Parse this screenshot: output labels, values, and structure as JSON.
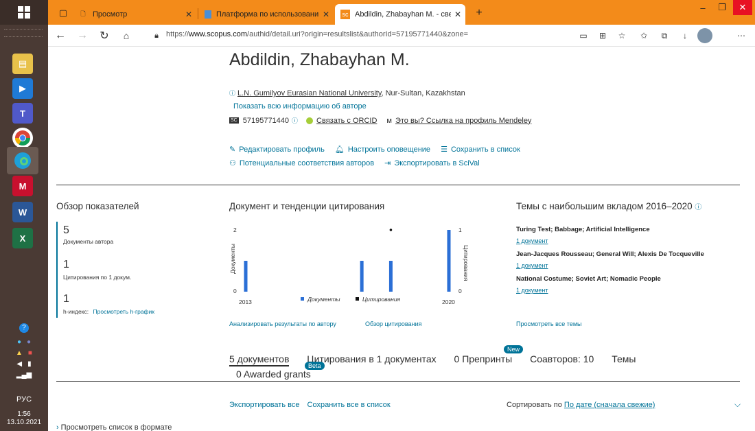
{
  "taskbar": {
    "language": "РУС",
    "time": "1:56",
    "date": "13.10.2021"
  },
  "browser": {
    "tabs": [
      {
        "title": "Просмотр"
      },
      {
        "title": "Платформа по использованию"
      },
      {
        "title": "Abdildin, Zhabayhan M. - сведе"
      }
    ],
    "url_prefix": "https://",
    "url_host": "www.scopus.com",
    "url_path": "/authid/detail.uri?origin=resultslist&authorId=57195771440&zone="
  },
  "author": {
    "name": "Abdildin, Zhabayhan M.",
    "affiliation_link": "L.N. Gumilyov Eurasian National University",
    "affiliation_rest": ", Nur-Sultan, Kazakhstan",
    "show_all": "Показать всю информацию об авторе",
    "scopus_id": "57195771440",
    "orcid_link": "Связать с ORCID",
    "mendeley_link": "Это вы? Ссылка на профиль Mendeley"
  },
  "actions": {
    "edit_profile": "Редактировать профиль",
    "alert": "Настроить оповещение",
    "save_list": "Сохранить в список",
    "potential_matches": "Потенциальные соответствия авторов",
    "export_scival": "Экспортировать в SciVal"
  },
  "metrics": {
    "title": "Обзор показателей",
    "docs_count": "5",
    "docs_label": "Документы автора",
    "citations_count": "1",
    "citations_label": "Цитирования по 1 докум.",
    "h_count": "1",
    "h_label": "h-индекс:",
    "h_link": "Просмотреть h-график"
  },
  "chart_section": {
    "title": "Документ и тенденции цитирования",
    "analyze_link": "Анализировать результаты по автору",
    "citation_overview": "Обзор цитирования"
  },
  "chart_data": {
    "type": "bar",
    "x_start_label": "2013",
    "x_end_label": "2020",
    "categories": [
      "2013",
      "2014",
      "2015",
      "2016",
      "2017",
      "2018",
      "2019",
      "2020"
    ],
    "series": [
      {
        "name": "Документы",
        "values": [
          1,
          0,
          0,
          0,
          1,
          1,
          0,
          2
        ],
        "color": "#2b6fd6"
      },
      {
        "name": "Цитирования",
        "values": [
          null,
          null,
          null,
          null,
          null,
          1,
          null,
          null
        ],
        "color": "#111111"
      }
    ],
    "ylabel_left": "Документы",
    "ylabel_right": "Цитирования",
    "ylim_left": [
      0,
      2
    ],
    "ylim_right": [
      0,
      1
    ],
    "left_ticks": [
      "0",
      "2"
    ],
    "right_ticks": [
      "0",
      "1"
    ]
  },
  "topics": {
    "title": "Темы с наибольшим вкладом 2016–2020",
    "items": [
      {
        "name": "Turing Test; Babbage; Artificial Intelligence",
        "docs": "1 документ"
      },
      {
        "name": "Jean-Jacques Rousseau; General Will; Alexis De Tocqueville",
        "docs": "1 документ"
      },
      {
        "name": "National Costume; Soviet Art; Nomadic People",
        "docs": "1 документ"
      }
    ],
    "view_all": "Просмотреть все темы"
  },
  "doc_tabs": {
    "documents": "5 документов",
    "citations": "Цитирования в 1 документах",
    "preprints": "0 Препринты",
    "coauthors": "Соавторов: 10",
    "topics": "Темы",
    "grants": "0 Awarded grants",
    "beta": "Beta",
    "new": "New"
  },
  "list_controls": {
    "export_all": "Экспортировать все",
    "save_all": "Сохранить все в список",
    "sort_by": "Сортировать по",
    "sort_value": "По дате (сначала свежие)",
    "view_list": "Просмотреть список в формате"
  }
}
